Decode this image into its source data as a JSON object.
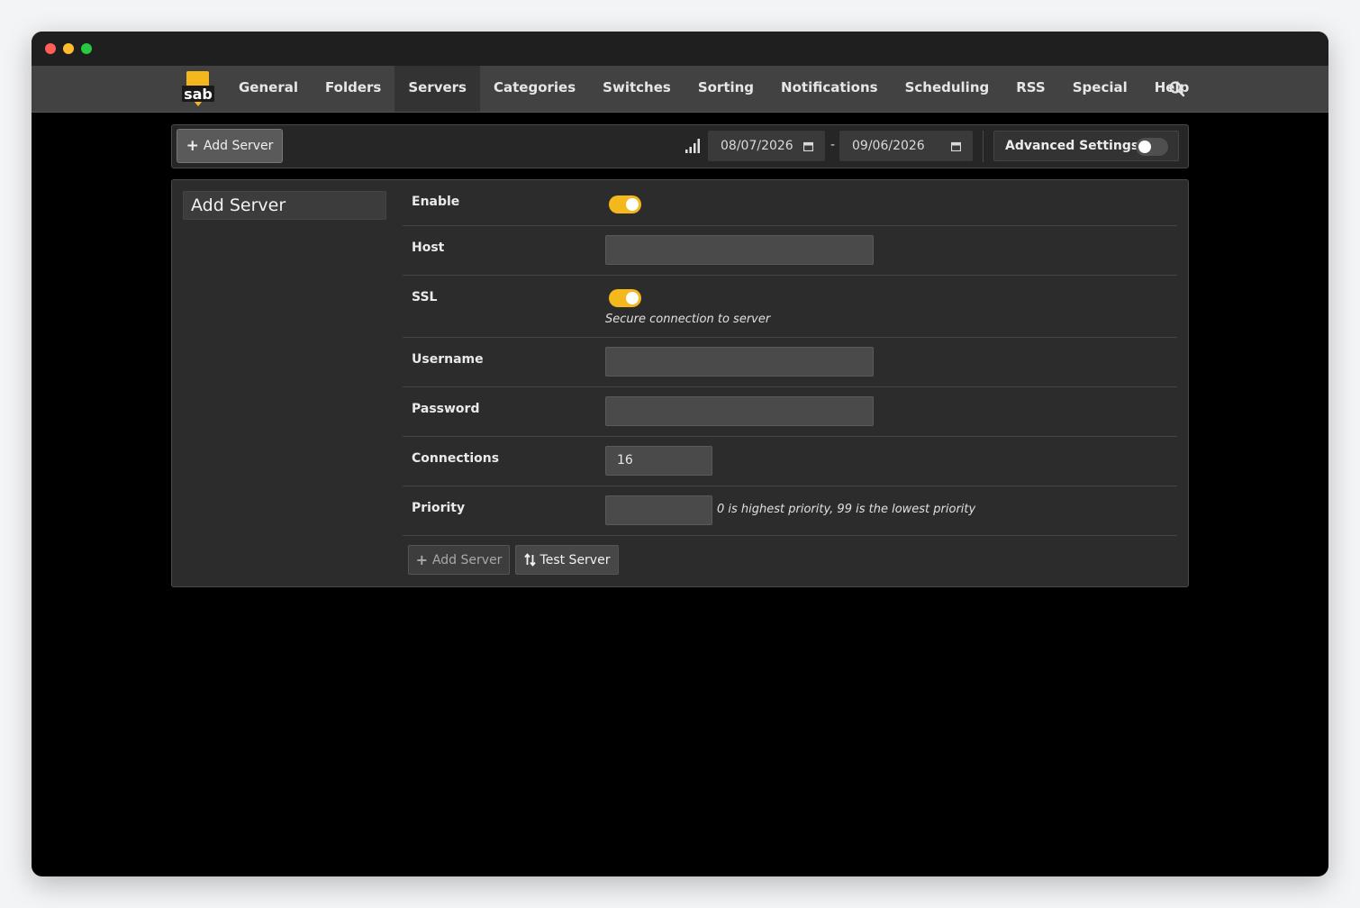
{
  "nav": {
    "items": [
      "General",
      "Folders",
      "Servers",
      "Categories",
      "Switches",
      "Sorting",
      "Notifications",
      "Scheduling",
      "RSS",
      "Special",
      "Help"
    ],
    "active": "Servers",
    "logo_text": "sab"
  },
  "toolbar": {
    "add_server_label": "Add Server",
    "date_from": "08/07/2026",
    "date_separator": "-",
    "date_to": "09/06/2026",
    "advanced_settings_label": "Advanced Settings",
    "advanced_settings_on": false
  },
  "form": {
    "title": "Add Server",
    "enable": {
      "label": "Enable",
      "on": true
    },
    "host": {
      "label": "Host",
      "value": ""
    },
    "ssl": {
      "label": "SSL",
      "on": true,
      "hint": "Secure connection to server"
    },
    "username": {
      "label": "Username",
      "value": ""
    },
    "password": {
      "label": "Password",
      "value": ""
    },
    "connections": {
      "label": "Connections",
      "value": "16"
    },
    "priority": {
      "label": "Priority",
      "value": "",
      "hint": "0 is highest priority, 99 is the lowest priority"
    },
    "add_button_label": "Add Server",
    "test_button_label": "Test Server"
  },
  "colors": {
    "accent_yellow": "#f4b81c",
    "background": "#000000",
    "panel": "#2c2c2c",
    "navbar": "#424242"
  }
}
